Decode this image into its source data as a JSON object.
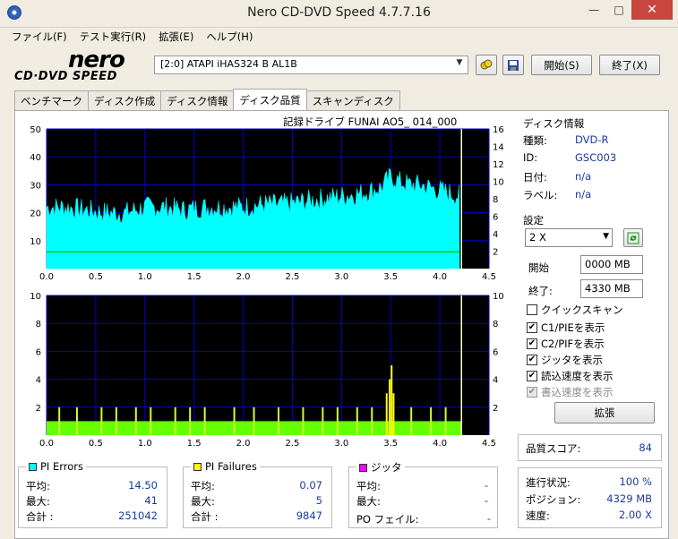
{
  "app": {
    "title": "Nero CD-DVD Speed 4.7.7.16",
    "logo_top": "nero",
    "logo_bottom": "CD·DVD SPEED"
  },
  "menu": [
    "ファイル(F)",
    "テスト実行(R)",
    "拡張(E)",
    "ヘルプ(H)"
  ],
  "toolbar": {
    "drive": "[2:0]   ATAPI iHAS324   B AL1B",
    "start_label": "開始(S)",
    "exit_label": "終了(X)"
  },
  "tabs": [
    "ベンチマーク",
    "ディスク作成",
    "ディスク情報",
    "ディスク品質",
    "スキャンディスク"
  ],
  "active_tab": 3,
  "chart_caption": "記録ドライブ FUNAI     AO5_ 014_000",
  "disc_info": {
    "heading": "ディスク情報",
    "type_label": "種類:",
    "type": "DVD-R",
    "id_label": "ID:",
    "id": "GSC003",
    "date_label": "日付:",
    "date": "n/a",
    "label_label": "ラベル:",
    "label": "n/a"
  },
  "settings": {
    "heading": "設定",
    "speed": "2 X",
    "start_label": "開始",
    "start": "0000 MB",
    "end_label": "終了:",
    "end": "4330 MB",
    "checks": [
      {
        "label": "クイックスキャン",
        "checked": false,
        "disabled": false
      },
      {
        "label": "C1/PIEを表示",
        "checked": true,
        "disabled": false
      },
      {
        "label": "C2/PIFを表示",
        "checked": true,
        "disabled": false
      },
      {
        "label": "ジッタを表示",
        "checked": true,
        "disabled": false
      },
      {
        "label": "読込速度を表示",
        "checked": true,
        "disabled": false
      },
      {
        "label": "書込速度を表示",
        "checked": true,
        "disabled": true
      }
    ],
    "advanced_label": "拡張"
  },
  "quality": {
    "label": "品質スコア:",
    "value": "84"
  },
  "progress": {
    "status_label": "進行状況:",
    "status": "100 %",
    "position_label": "ポジション:",
    "position": "4329 MB",
    "speed_label": "速度:",
    "speed": "2.00 X"
  },
  "pi_errors": {
    "title": "PI Errors",
    "avg_label": "平均:",
    "avg": "14.50",
    "max_label": "最大:",
    "max": "41",
    "total_label": "合計 :",
    "total": "251042",
    "color": "#00ffff"
  },
  "pi_failures": {
    "title": "PI Failures",
    "avg_label": "平均:",
    "avg": "0.07",
    "max_label": "最大:",
    "max": "5",
    "total_label": "合計 :",
    "total": "9847",
    "color": "#ffff00"
  },
  "jitter": {
    "title": "ジッタ",
    "avg_label": "平均:",
    "avg": "-",
    "max_label": "最大:",
    "max": "-",
    "po_label": "PO フェイル:",
    "po": "-",
    "color": "#ff00ff"
  },
  "colors": {
    "pie": "#00ffff",
    "pif": "#ffff00",
    "pif_base": "#66ff00",
    "grid": "#0000cc",
    "speed_line": "#00cc00",
    "end_marker": "#ffffcc"
  },
  "chart_data": [
    {
      "type": "area",
      "name_hidden": "PIE",
      "x_ticks": [
        "0.0",
        "0.5",
        "1.0",
        "1.5",
        "2.0",
        "2.5",
        "3.0",
        "3.5",
        "4.0",
        "4.5"
      ],
      "y_left_ticks": [
        "50",
        "40",
        "30",
        "20",
        "10"
      ],
      "y_right_ticks": [
        "16",
        "14",
        "12",
        "10",
        "8",
        "6",
        "4",
        "2"
      ],
      "xlim": [
        0,
        4.5
      ],
      "ylim": [
        0,
        50
      ],
      "x": [
        0,
        0.2,
        0.4,
        0.6,
        0.8,
        1.0,
        1.2,
        1.4,
        1.6,
        1.8,
        2.0,
        2.2,
        2.4,
        2.6,
        2.8,
        3.0,
        3.2,
        3.4,
        3.5,
        3.6,
        3.7,
        3.8,
        3.9,
        4.0,
        4.1,
        4.2
      ],
      "values": [
        22,
        22,
        21,
        20,
        20,
        22,
        22,
        21,
        22,
        22,
        22,
        23,
        23,
        24,
        25,
        26,
        27,
        29,
        33,
        31,
        30,
        30,
        29,
        28,
        27,
        26
      ],
      "speed_level": 6
    },
    {
      "type": "bar",
      "name_hidden": "PIF",
      "x_ticks": [
        "0.0",
        "0.5",
        "1.0",
        "1.5",
        "2.0",
        "2.5",
        "3.0",
        "3.5",
        "4.0",
        "4.5"
      ],
      "y_left_ticks": [
        "10",
        "8",
        "6",
        "4",
        "2"
      ],
      "y_right_ticks": [
        "10",
        "8",
        "6",
        "4",
        "2"
      ],
      "xlim": [
        0,
        4.5
      ],
      "ylim": [
        0,
        10
      ],
      "base": 1,
      "spikes": [
        [
          0.12,
          2
        ],
        [
          0.3,
          2
        ],
        [
          0.55,
          2
        ],
        [
          0.7,
          2
        ],
        [
          0.9,
          2
        ],
        [
          1.05,
          2
        ],
        [
          1.3,
          2
        ],
        [
          1.45,
          2
        ],
        [
          1.6,
          2
        ],
        [
          1.9,
          2
        ],
        [
          2.1,
          2
        ],
        [
          2.35,
          2
        ],
        [
          2.6,
          2
        ],
        [
          2.8,
          2
        ],
        [
          2.95,
          2
        ],
        [
          3.15,
          2
        ],
        [
          3.3,
          2
        ],
        [
          3.45,
          3
        ],
        [
          3.48,
          4
        ],
        [
          3.5,
          5
        ],
        [
          3.52,
          3
        ],
        [
          3.7,
          2
        ],
        [
          3.9,
          2
        ],
        [
          4.05,
          2
        ]
      ],
      "end_marker": 4.22
    }
  ]
}
